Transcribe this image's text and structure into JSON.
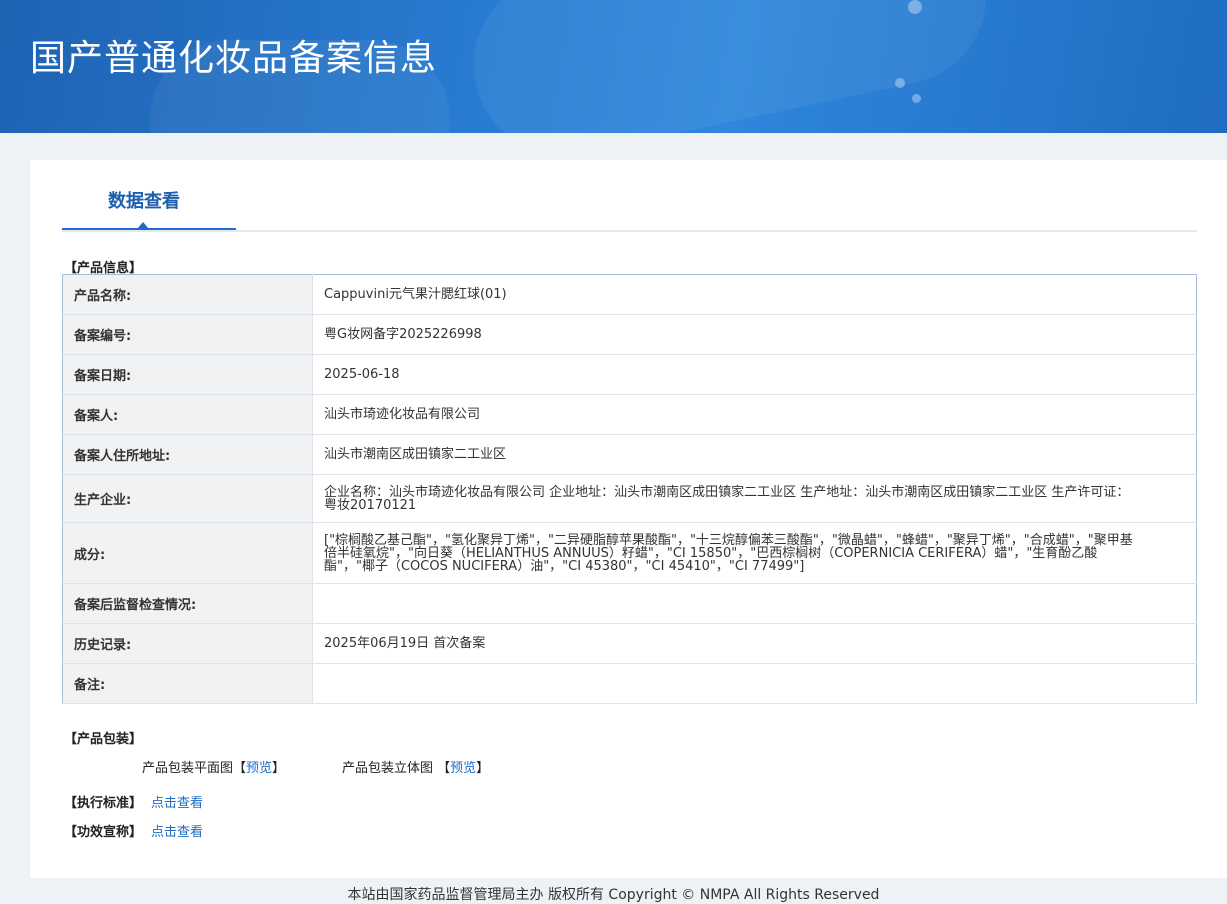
{
  "header": {
    "title": "国产普通化妆品备案信息"
  },
  "tabs": [
    {
      "label": "数据查看"
    }
  ],
  "product_section": {
    "title": "【产品信息】"
  },
  "product_rows": [
    {
      "label": "产品名称:",
      "value": "Cappuvini元气果汁腮红球(01)"
    },
    {
      "label": "备案编号:",
      "value": "粤G妆网备字2025226998"
    },
    {
      "label": "备案日期:",
      "value": "2025-06-18"
    },
    {
      "label": "备案人:",
      "value": "汕头市琦迹化妆品有限公司"
    },
    {
      "label": "备案人住所地址:",
      "value": "汕头市潮南区成田镇家二工业区"
    },
    {
      "label": "生产企业:",
      "value": "企业名称：汕头市琦迹化妆品有限公司 企业地址：汕头市潮南区成田镇家二工业区 生产地址：汕头市潮南区成田镇家二工业区 生产许可证：粤妆20170121"
    },
    {
      "label": "成分:",
      "value": "[\"棕榈酸乙基己酯\"，\"氢化聚异丁烯\"，\"二异硬脂醇苹果酸酯\"，\"十三烷醇偏苯三酸酯\"，\"微晶蜡\"，\"蜂蜡\"，\"聚异丁烯\"，\"合成蜡\"，\"聚甲基倍半硅氧烷\"，\"向日葵（HELIANTHUS ANNUUS）籽蜡\"，\"CI 15850\"，\"巴西棕榈树（COPERNICIA CERIFERA）蜡\"，\"生育酚乙酸酯\"，\"椰子（COCOS NUCIFERA）油\"，\"CI 45380\"，\"CI 45410\"，\"CI 77499\"]"
    },
    {
      "label": "备案后监督检查情况:",
      "value": ""
    },
    {
      "label": "历史记录:",
      "value": "2025年06月19日 首次备案"
    },
    {
      "label": "备注:",
      "value": ""
    }
  ],
  "packaging": {
    "title": "【产品包装】",
    "flat_label": "产品包装平面图【",
    "flat_link": "预览",
    "flat_close": "】",
    "solid_label": "产品包装立体图 【",
    "solid_link": "预览",
    "solid_close": "】"
  },
  "standard": {
    "title": "【执行标准】",
    "link": "点击查看"
  },
  "efficacy": {
    "title": "【功效宣称】",
    "link": "点击查看"
  },
  "footer": {
    "text": "本站由国家药品监督管理局主办 版权所有 Copyright © NMPA All Rights Reserved"
  }
}
